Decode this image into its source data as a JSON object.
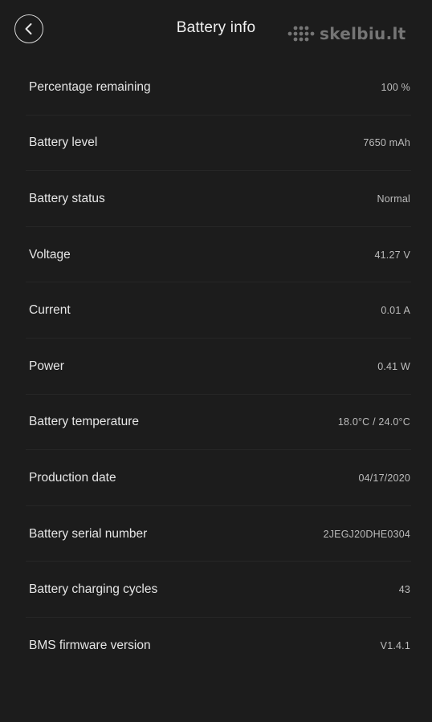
{
  "header": {
    "title": "Battery info",
    "back_icon": "chevron-left-icon"
  },
  "watermark": {
    "text": "skelbiu.lt"
  },
  "rows": [
    {
      "label": "Percentage remaining",
      "value": "100 %"
    },
    {
      "label": "Battery level",
      "value": "7650 mAh"
    },
    {
      "label": "Battery status",
      "value": "Normal"
    },
    {
      "label": "Voltage",
      "value": "41.27 V"
    },
    {
      "label": "Current",
      "value": "0.01 A"
    },
    {
      "label": "Power",
      "value": "0.41 W"
    },
    {
      "label": "Battery temperature",
      "value": "18.0°C / 24.0°C"
    },
    {
      "label": "Production date",
      "value": "04/17/2020"
    },
    {
      "label": "Battery serial number",
      "value": "2JEGJ20DHE0304"
    },
    {
      "label": "Battery charging cycles",
      "value": "43"
    },
    {
      "label": "BMS firmware version",
      "value": "V1.4.1"
    }
  ],
  "colors": {
    "background": "#1c1c1c",
    "text_primary": "#e6e6e6",
    "text_secondary": "#bdbdbd",
    "divider": "#262626"
  }
}
